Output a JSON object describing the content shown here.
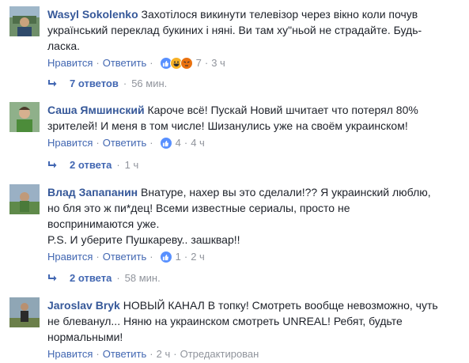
{
  "accent_color": "#365899",
  "link_color": "#4267b2",
  "meta_color": "#90949c",
  "comments": [
    {
      "author": "Wasyl Sokolenko",
      "text_lines": [
        "Захотілося викинути телевізор через вікно коли почув",
        "український переклад букиних і няні. Ви там ху\"ньой не страдайте. Будь-",
        "ласка."
      ],
      "like_label": "Нравится",
      "reply_label": "Ответить",
      "reactions": [
        "like",
        "haha",
        "angry"
      ],
      "reaction_count": "7",
      "time": "3 ч"
    },
    {
      "author": "Саша Ямшинский",
      "text_lines": [
        "Кароче всё! Пускай Новий шчитает что потерял 80%",
        "зрителей! И меня в том числе! Шизанулись уже на своём украинском!"
      ],
      "like_label": "Нравится",
      "reply_label": "Ответить",
      "reactions": [
        "like"
      ],
      "reaction_count": "4",
      "time": "4 ч"
    },
    {
      "author": "Влад Запапанин",
      "text_lines": [
        "Внатуре, нахер вы это сделали!?? Я украинский люблю,",
        "но бля это ж пи*дец! Всеми известные сериалы, просто не",
        "воспринимаются уже.",
        "P.S. И уберите Пушкареву.. зашквар!!"
      ],
      "like_label": "Нравится",
      "reply_label": "Ответить",
      "reactions": [
        "like"
      ],
      "reaction_count": "1",
      "time": "2 ч"
    },
    {
      "author": "Jaroslav Bryk",
      "text_lines": [
        "НОВЫЙ КАНАЛ В топку! Смотреть вообще невозможно, чуть",
        "не блеванул... Няню на украинском смотреть UNREAL! Ребят, будьте",
        "нормальными!"
      ],
      "like_label": "Нравится",
      "reply_label": "Ответить",
      "time": "2 ч",
      "edited_label": "Отредактирован"
    }
  ],
  "reply_threads": [
    {
      "count_label": "7 ответов",
      "time": "56 мин."
    },
    {
      "count_label": "2 ответа",
      "time": "1 ч"
    },
    {
      "count_label": "2 ответа",
      "time": "58 мин."
    }
  ]
}
